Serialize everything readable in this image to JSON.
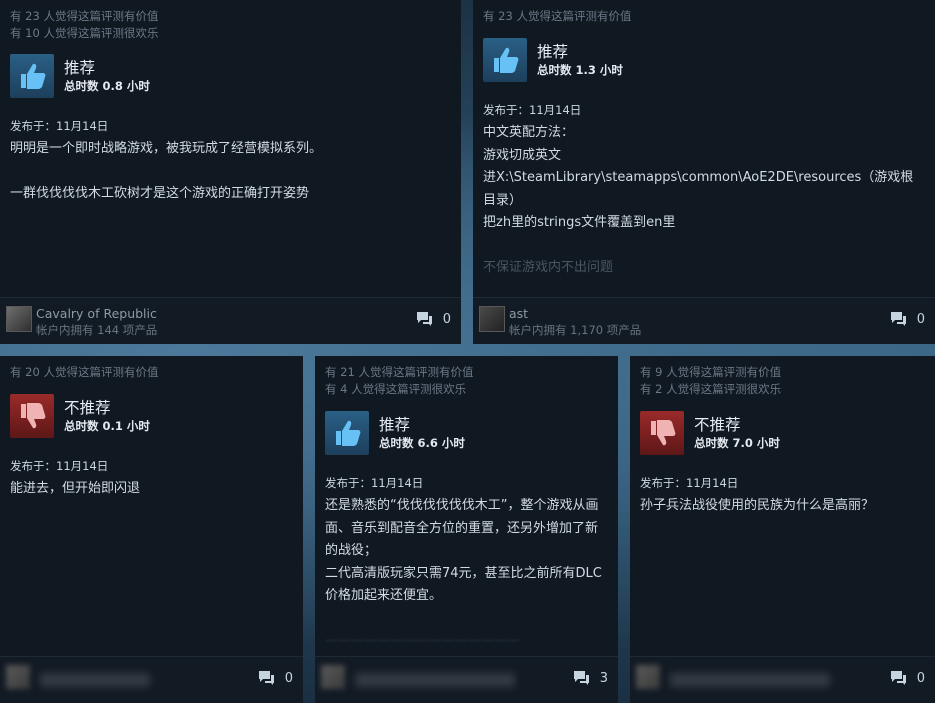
{
  "reviews": [
    {
      "helpful": "有 23 人觉得这篇评测有价值",
      "funny": "有 10 人觉得这篇评测很欢乐",
      "verdict": "推荐",
      "thumb": "thumbs-up-icon",
      "hours": "总时数 0.8 小时",
      "posted": "发布于：11月14日",
      "body": [
        "明明是一个即时战略游戏，被我玩成了经营模拟系列。",
        "",
        "一群伐伐伐伐木工砍树才是这个游戏的正确打开姿势"
      ],
      "author": "Cavalry of Republic",
      "products": "帐户内拥有 144 项产品",
      "comments": "0"
    },
    {
      "helpful": "有 23 人觉得这篇评测有价值",
      "funny": "",
      "verdict": "推荐",
      "thumb": "thumbs-up-icon",
      "hours": "总时数 1.3 小时",
      "posted": "发布于：11月14日",
      "body": [
        "中文英配方法：",
        "游戏切成英文",
        "进X:\\SteamLibrary\\steamapps\\common\\AoE2DE\\resources（游戏根目录）",
        "把zh里的strings文件覆盖到en里",
        "",
        "不保证游戏内不出问题"
      ],
      "author": "ast",
      "products": "帐户内拥有 1,170 项产品",
      "comments": "0"
    },
    {
      "helpful": "有 20 人觉得这篇评测有价值",
      "funny": "",
      "verdict": "不推荐",
      "thumb": "thumbs-down-icon",
      "hours": "总时数 0.1 小时",
      "posted": "发布于：11月14日",
      "body": [
        "能进去，但开始即闪退"
      ],
      "author": "",
      "products": "",
      "comments": "0"
    },
    {
      "helpful": "有 21 人觉得这篇评测有价值",
      "funny": "有 4 人觉得这篇评测很欢乐",
      "verdict": "推荐",
      "thumb": "thumbs-up-icon",
      "hours": "总时数 6.6 小时",
      "posted": "发布于：11月14日",
      "body": [
        "还是熟悉的“伐伐伐伐伐伐木工”，整个游戏从画面、音乐到配音全方位的重置，还另外增加了新的战役；",
        "二代高清版玩家只需74元，甚至比之前所有DLC价格加起来还便宜。"
      ],
      "author": "",
      "products": "",
      "comments": "3"
    },
    {
      "helpful": "有 9 人觉得这篇评测有价值",
      "funny": "有 2 人觉得这篇评测很欢乐",
      "verdict": "不推荐",
      "thumb": "thumbs-down-icon",
      "hours": "总时数 7.0 小时",
      "posted": "发布于：11月14日",
      "body": [
        "孙子兵法战役使用的民族为什么是高丽？"
      ],
      "author": "",
      "products": "",
      "comments": "0"
    }
  ],
  "icons": {
    "comment": "comment-bubble-icon"
  },
  "colors": {
    "card_bg": "#101822",
    "up_thumb": "#1d3f5c",
    "down_thumb": "#8a2222",
    "page_bg": "#2a475e"
  }
}
